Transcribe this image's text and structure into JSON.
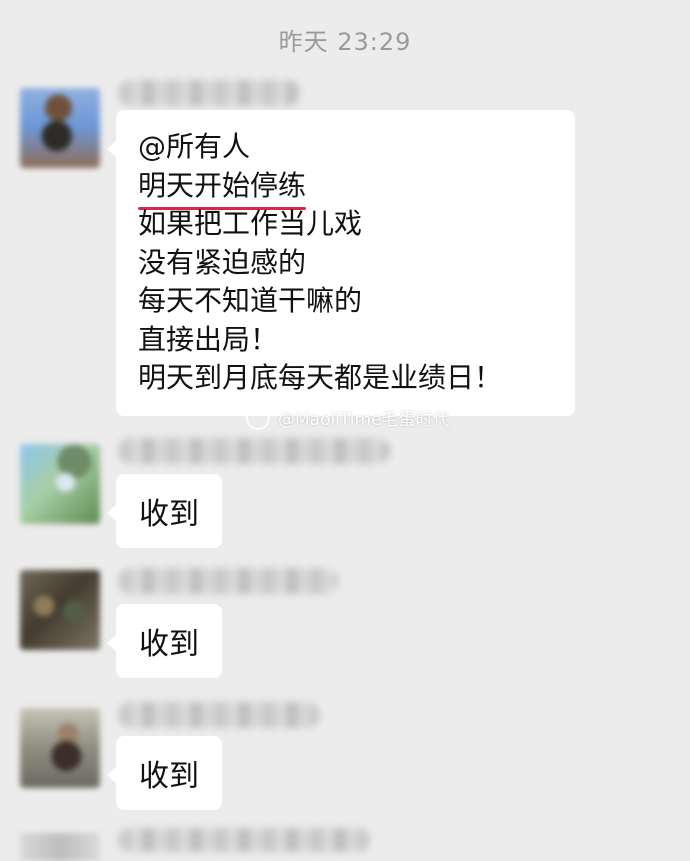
{
  "chat": {
    "timestamp": "昨天 23:29",
    "message": {
      "lines": [
        "@所有人",
        "明天开始停练",
        "如果把工作当儿戏",
        "没有紧迫感的",
        "每天不知道干嘛的",
        "直接出局！",
        "明天到月底每天都是业绩日！"
      ]
    },
    "replies": [
      {
        "text": "收到"
      },
      {
        "text": "收到"
      },
      {
        "text": "收到"
      }
    ],
    "watermark": "@MaoliTime毛蛋时代",
    "accent": "#d9264b"
  }
}
